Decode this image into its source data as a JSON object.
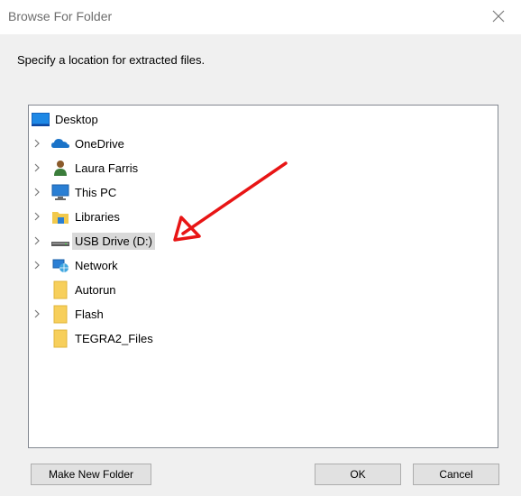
{
  "dialog": {
    "title": "Browse For Folder",
    "close_icon": "close-icon",
    "instruction": "Specify a location for extracted files."
  },
  "tree": {
    "items": [
      {
        "label": "Desktop",
        "icon": "desktop-icon",
        "expandable": false,
        "level": 0
      },
      {
        "label": "OneDrive",
        "icon": "onedrive-cloud-icon",
        "expandable": true,
        "level": 1
      },
      {
        "label": "Laura Farris",
        "icon": "user-icon",
        "expandable": true,
        "level": 1
      },
      {
        "label": "This PC",
        "icon": "this-pc-icon",
        "expandable": true,
        "level": 1
      },
      {
        "label": "Libraries",
        "icon": "libraries-icon",
        "expandable": true,
        "level": 1
      },
      {
        "label": "USB Drive (D:)",
        "icon": "usb-drive-icon",
        "expandable": true,
        "level": 1,
        "selected": true
      },
      {
        "label": "Network",
        "icon": "network-icon",
        "expandable": true,
        "level": 1
      },
      {
        "label": "Autorun",
        "icon": "folder-icon",
        "expandable": false,
        "level": 1
      },
      {
        "label": "Flash",
        "icon": "folder-icon",
        "expandable": true,
        "level": 1
      },
      {
        "label": "TEGRA2_Files",
        "icon": "folder-icon",
        "expandable": false,
        "level": 1
      }
    ]
  },
  "buttons": {
    "make_new_folder": "Make New Folder",
    "ok": "OK",
    "cancel": "Cancel"
  },
  "colors": {
    "arrow": "#e81515",
    "selection": "#d9d9d9",
    "folder": "#f7cf5b"
  }
}
